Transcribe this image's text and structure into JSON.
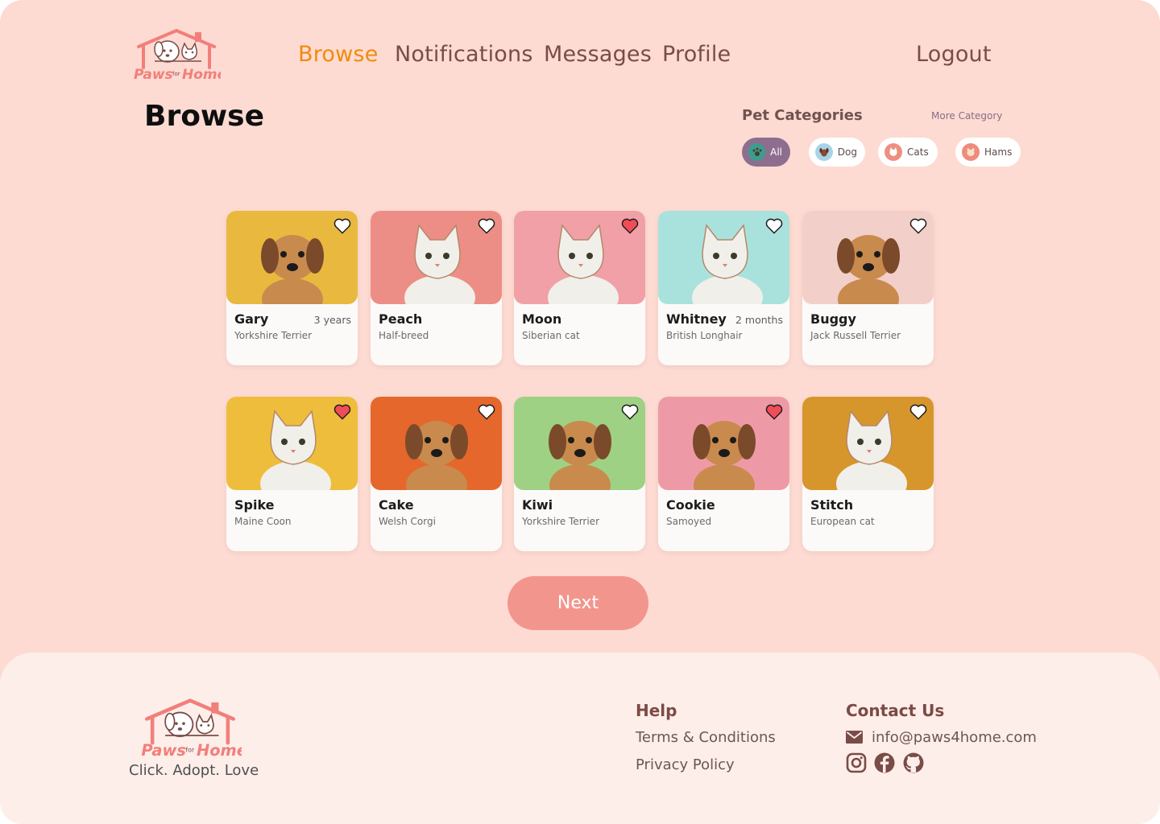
{
  "brand": {
    "logo_lettering": "Paws for Home",
    "primary_color": "#f27f7a",
    "background": "#fddbd2",
    "footer_background": "#fdeeea"
  },
  "nav": {
    "items": [
      {
        "label": "Browse",
        "active": true
      },
      {
        "label": "Notifications",
        "active": false
      },
      {
        "label": "Messages",
        "active": false
      },
      {
        "label": "Profile",
        "active": false
      }
    ],
    "logout": "Logout"
  },
  "page_title": "Browse",
  "categories": {
    "title": "Pet Categories",
    "more": "More Category",
    "chips": [
      {
        "label": "All",
        "icon": "paw-icon",
        "selected": true
      },
      {
        "label": "Dog",
        "icon": "dog-icon",
        "selected": false
      },
      {
        "label": "Cats",
        "icon": "cat-icon",
        "selected": false
      },
      {
        "label": "Hams",
        "icon": "hamster-icon",
        "selected": false
      }
    ]
  },
  "pets": [
    {
      "name": "Gary",
      "age": "3 years",
      "breed": "Yorkshire Terrier",
      "favorite": false,
      "bg": "#e9b93f",
      "animal": "dog"
    },
    {
      "name": "Peach",
      "age": "",
      "breed": "Half-breed",
      "favorite": false,
      "bg": "#ec8e86",
      "animal": "cat"
    },
    {
      "name": "Moon",
      "age": "",
      "breed": "Siberian cat",
      "favorite": true,
      "bg": "#f0a0a6",
      "animal": "cat"
    },
    {
      "name": "Whitney",
      "age": "2 months",
      "breed": "British Longhair",
      "favorite": false,
      "bg": "#a9e2dc",
      "animal": "cat"
    },
    {
      "name": "Buggy",
      "age": "",
      "breed": "Jack Russell Terrier",
      "favorite": false,
      "bg": "#f2cfc8",
      "animal": "dog"
    },
    {
      "name": "Spike",
      "age": "",
      "breed": "Maine Coon",
      "favorite": true,
      "bg": "#efbd3c",
      "animal": "cat"
    },
    {
      "name": "Cake",
      "age": "",
      "breed": "Welsh Corgi",
      "favorite": false,
      "bg": "#e5672b",
      "animal": "dog"
    },
    {
      "name": "Kiwi",
      "age": "",
      "breed": "Yorkshire Terrier",
      "favorite": false,
      "bg": "#9ed183",
      "animal": "dog"
    },
    {
      "name": "Cookie",
      "age": "",
      "breed": "Samoyed",
      "favorite": true,
      "bg": "#ee9aa6",
      "animal": "dog"
    },
    {
      "name": "Stitch",
      "age": "",
      "breed": "European cat",
      "favorite": false,
      "bg": "#d7962b",
      "animal": "cat"
    }
  ],
  "next_button": "Next",
  "footer": {
    "tagline": "Click. Adopt. Love",
    "help": {
      "title": "Help",
      "links": [
        "Terms & Conditions",
        "Privacy Policy"
      ]
    },
    "contact": {
      "title": "Contact Us",
      "email": "info@paws4home.com",
      "socials": [
        "instagram-icon",
        "facebook-icon",
        "github-icon"
      ]
    }
  }
}
